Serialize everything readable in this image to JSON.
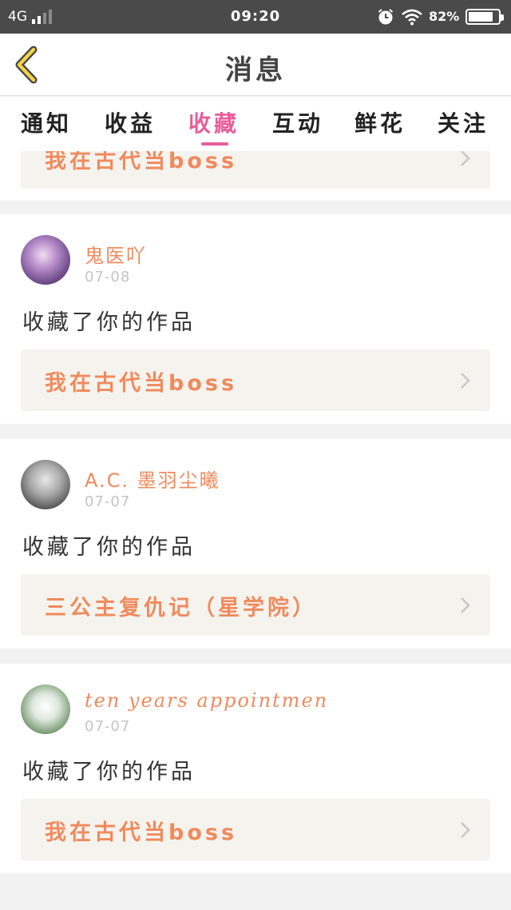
{
  "status_bar": {
    "network": "4G",
    "time": "09:20",
    "battery_percent": "82%",
    "battery_level": 0.82,
    "icons": [
      "signal-icon",
      "alarm-icon",
      "wifi-icon",
      "battery-icon"
    ]
  },
  "header": {
    "title": "消息",
    "back_icon": "back-chevron-icon"
  },
  "tabs": [
    {
      "label": "通知",
      "active": false
    },
    {
      "label": "收益",
      "active": false
    },
    {
      "label": "收藏",
      "active": true
    },
    {
      "label": "互动",
      "active": false
    },
    {
      "label": "鲜花",
      "active": false
    },
    {
      "label": "关注",
      "active": false
    }
  ],
  "colors": {
    "accent": "#e75d9b",
    "name_color": "#f08a5d",
    "status_bar_bg": "#4a4a4a"
  },
  "partial_top": {
    "work_title": "我在古代当boss"
  },
  "messages": [
    {
      "username": "鬼医吖",
      "date": "07-08",
      "action": "收藏了你的作品",
      "work_title": "我在古代当boss"
    },
    {
      "username": "A.C. 墨羽尘曦",
      "date": "07-07",
      "action": "收藏了你的作品",
      "work_title": "三公主复仇记（星学院）"
    },
    {
      "username": "ten years appointmen",
      "date": "07-07",
      "action": "收藏了你的作品",
      "work_title": "我在古代当boss"
    }
  ]
}
